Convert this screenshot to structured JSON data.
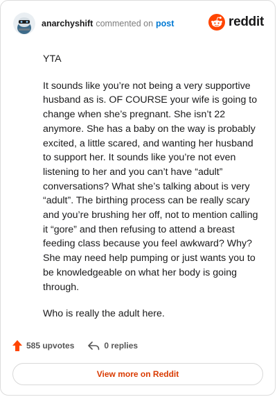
{
  "comment": {
    "username": "anarchyshift",
    "action": "commented on",
    "post_link": "post",
    "paragraphs": [
      "YTA",
      "It sounds like you’re not being a very supportive husband as is. OF COURSE your wife is going to change when she’s pregnant. She isn’t 22 anymore. She has a baby on the way is probably excited, a little scared, and wanting her husband to support her. It sounds like you’re not even listening to her and you can’t have “adult” conversations? What she’s talking about is very “adult”. The birthing process can be really scary and you’re brushing her off, not to mention calling it “gore” and then refusing to attend a breast feeding class because you feel awkward? Why? She may need help pumping or just wants you to be knowledgeable on what her body is going through.",
      "Who is really the adult here."
    ]
  },
  "brand": {
    "name": "reddit",
    "icon": "reddit-logo-icon",
    "color": "#ff4500"
  },
  "footer": {
    "upvotes": "585 upvotes",
    "upvote_icon": "upvote-arrow-icon",
    "upvote_color": "#ff4500",
    "replies": "0 replies",
    "reply_icon": "reply-arrow-icon"
  },
  "cta": {
    "label": "View more on Reddit",
    "color": "#d93a00"
  }
}
